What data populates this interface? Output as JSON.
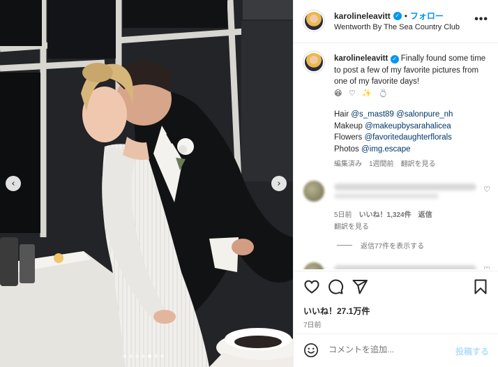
{
  "post": {
    "username": "karolineleavitt",
    "separator": "•",
    "follow_label": "フォロー",
    "location": "Wentworth By The Sea Country Club",
    "more_label": "•••"
  },
  "caption": {
    "username": "karolineleavitt",
    "text": "Finally found some time to post a few of my favorite pictures from one of my favorite days!",
    "emojis": "😆 ♡ ✨ 💍",
    "credits": [
      {
        "label": "Hair",
        "tags": [
          "@s_mast89",
          "@salonpure_nh"
        ]
      },
      {
        "label": "Makeup",
        "tags": [
          "@makeupbysarahalicea"
        ]
      },
      {
        "label": "Flowers",
        "tags": [
          "@favoritedaughterflorals"
        ]
      },
      {
        "label": "Photos",
        "tags": [
          "@img.escape"
        ]
      }
    ],
    "edited": "編集済み",
    "time": "1週間前",
    "see_translation": "翻訳を見る"
  },
  "comment": {
    "time": "5日前",
    "likes": "いいね！1,324件",
    "reply": "返信",
    "see_translation": "翻訳を見る",
    "view_replies": "返信77件を表示する"
  },
  "actions": {
    "likes": "いいね！27.1万件",
    "date": "7日前"
  },
  "composer": {
    "placeholder": "コメントを追加...",
    "post_label": "投稿する"
  },
  "carousel": {
    "prev": "‹",
    "next": "›",
    "slide_count": 7,
    "active_slide": 4
  },
  "colors": {
    "link": "#00376b",
    "accent": "#0095f6",
    "muted": "#737373"
  }
}
